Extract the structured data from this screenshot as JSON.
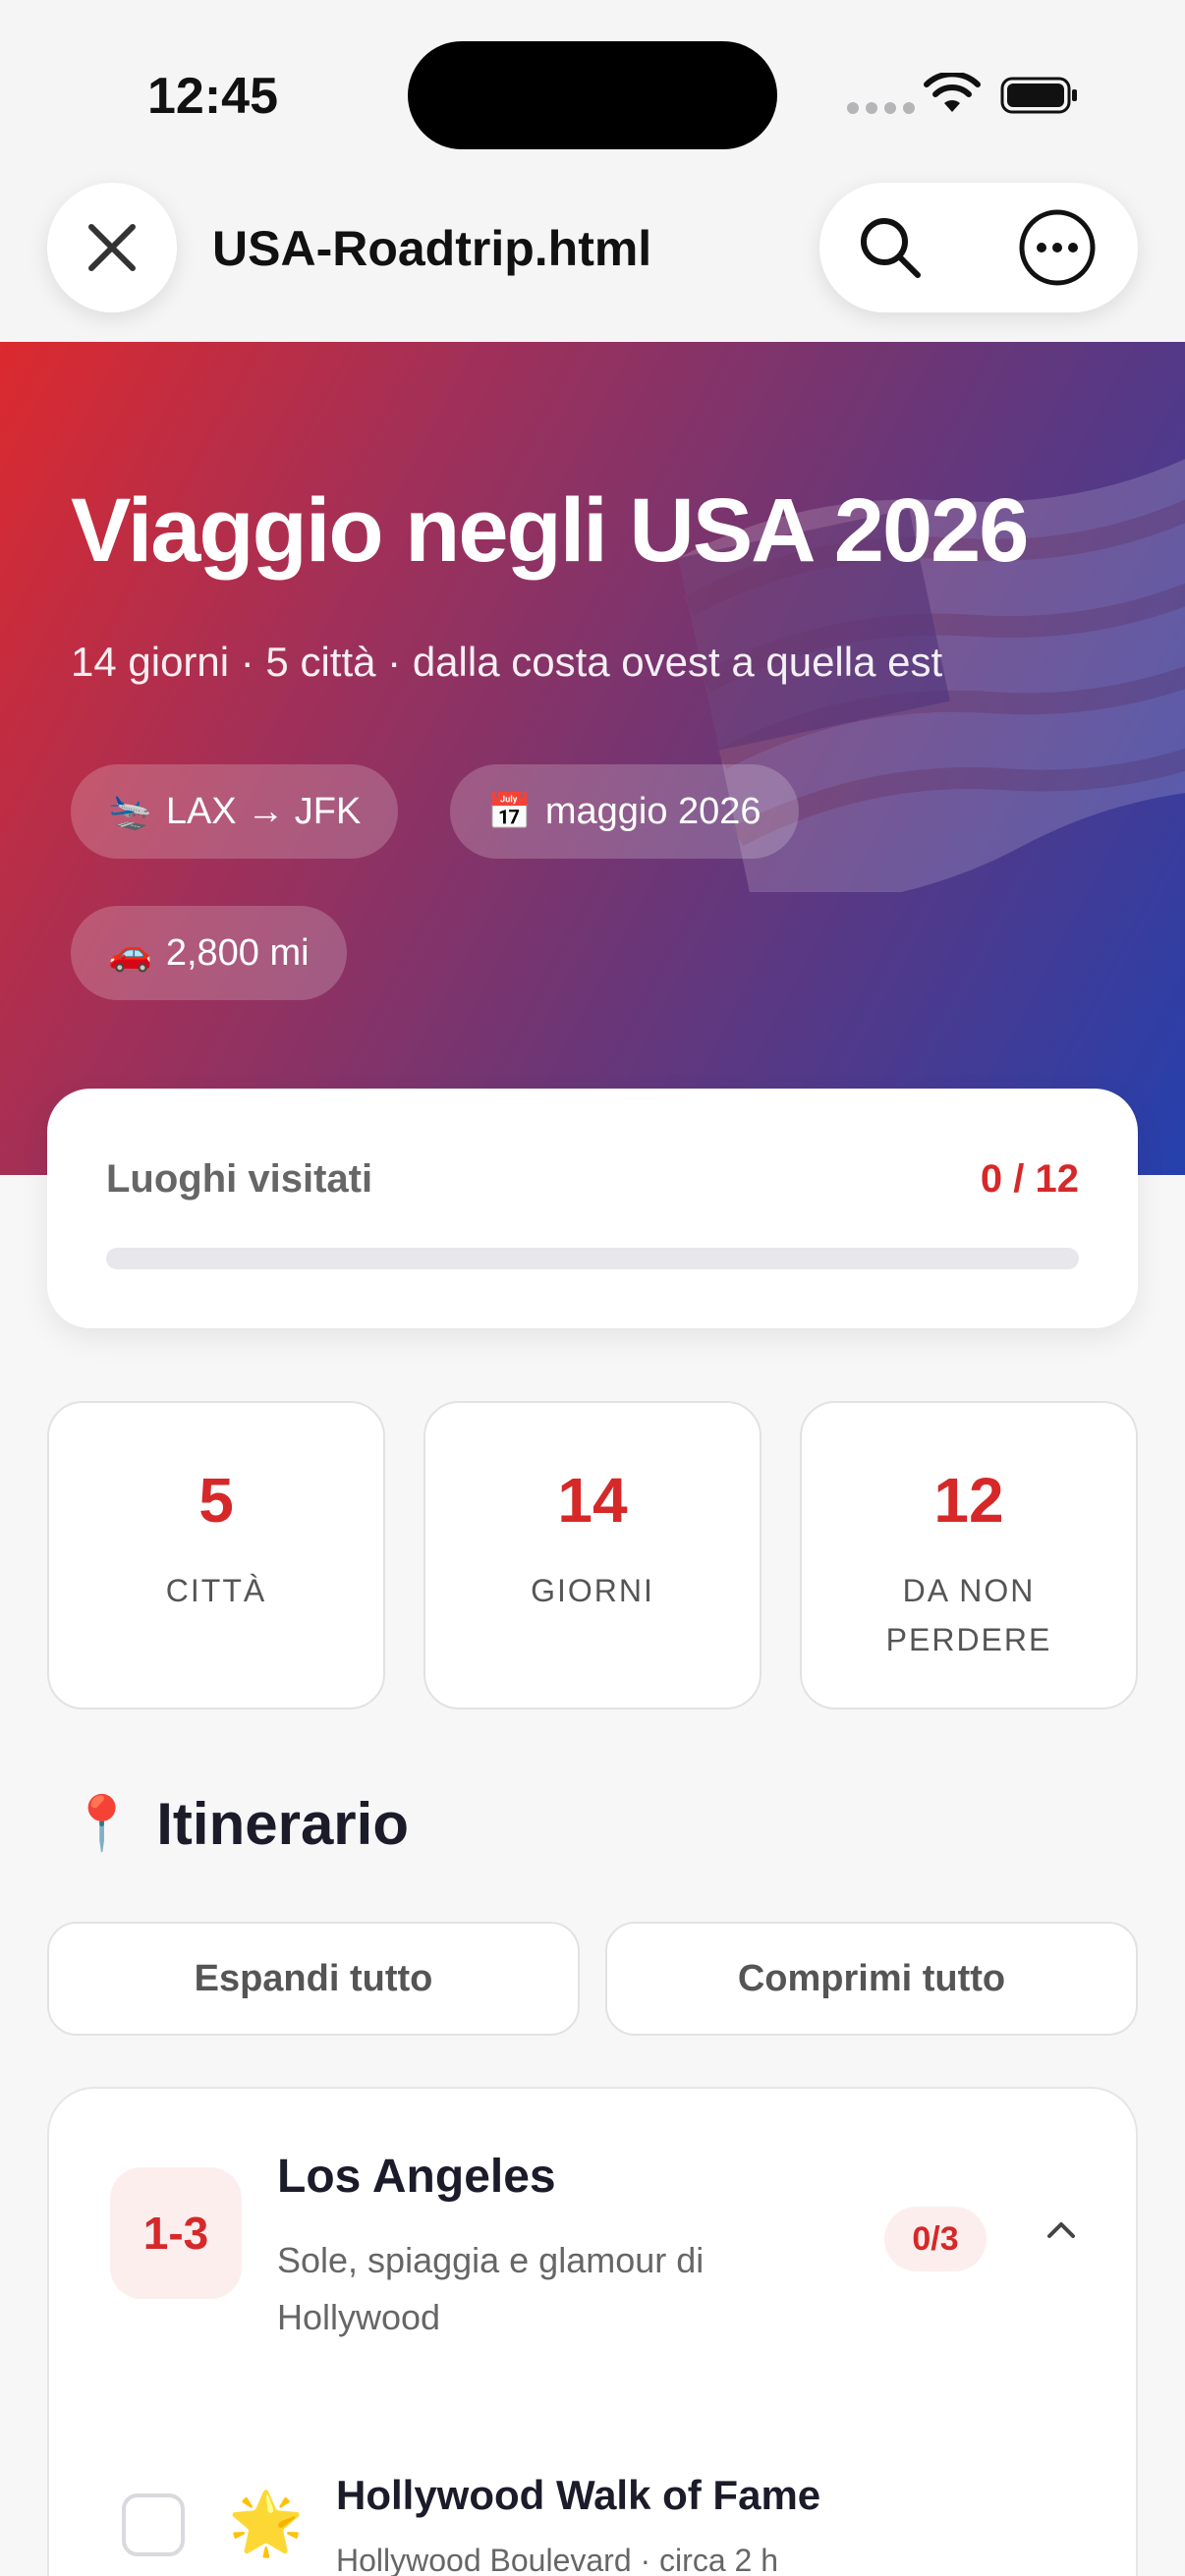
{
  "status": {
    "time": "12:45"
  },
  "browser": {
    "title": "USA-Roadtrip.html"
  },
  "hero": {
    "title": "Viaggio negli USA 2026",
    "subtitle": "14 giorni · 5 città · dalla costa ovest a quella est",
    "chips": [
      {
        "icon": "🛬",
        "label": "LAX → JFK"
      },
      {
        "icon": "📅",
        "label": "maggio 2026"
      },
      {
        "icon": "🚗",
        "label": "2,800 mi"
      }
    ]
  },
  "progress": {
    "label": "Luoghi visitati",
    "count": "0 / 12",
    "fraction": 0
  },
  "stats": [
    {
      "value": "5",
      "label": "CITTÀ"
    },
    {
      "value": "14",
      "label": "GIORNI"
    },
    {
      "value": "12",
      "label": "DA NON PERDERE"
    }
  ],
  "itinerary": {
    "icon": "📍",
    "title": "Itinerario",
    "expand_label": "Espandi tutto",
    "collapse_label": "Comprimi tutto",
    "cities": [
      {
        "days": "1-3",
        "name": "Los Angeles",
        "description": "Sole, spiaggia e glamour di Hollywood",
        "count": "0/3",
        "places": [
          {
            "icon": "🌟",
            "name": "Hollywood Walk of Fame",
            "meta": "Hollywood Boulevard · circa 2 h",
            "checked": false
          }
        ]
      }
    ]
  },
  "colors": {
    "accent": "#d62828",
    "hero_start": "#dc2a2e",
    "hero_end": "#2540ad"
  }
}
